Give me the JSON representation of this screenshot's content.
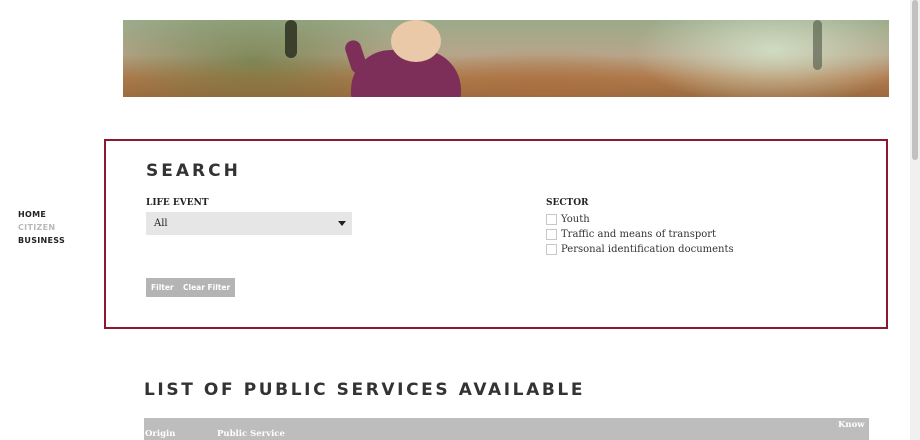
{
  "nav": {
    "items": [
      {
        "label": "HOME",
        "active": false
      },
      {
        "label": "CITIZEN",
        "active": true
      },
      {
        "label": "BUSINESS",
        "active": false
      }
    ]
  },
  "search": {
    "title": "SEARCH",
    "life_event": {
      "label": "LIFE EVENT",
      "selected": "All"
    },
    "sector": {
      "label": "SECTOR",
      "options": [
        "Youth",
        "Traffic and means of transport",
        "Personal identification documents"
      ]
    },
    "filter_label": "Filter",
    "clear_label": "Clear Filter"
  },
  "list": {
    "title": "LIST OF PUBLIC SERVICES AVAILABLE",
    "columns": [
      "Origin",
      "Public Service",
      "Know"
    ]
  },
  "colors": {
    "border_accent": "#8a1a32",
    "button": "#b4b4b4",
    "table_header": "#bdbdbd"
  }
}
